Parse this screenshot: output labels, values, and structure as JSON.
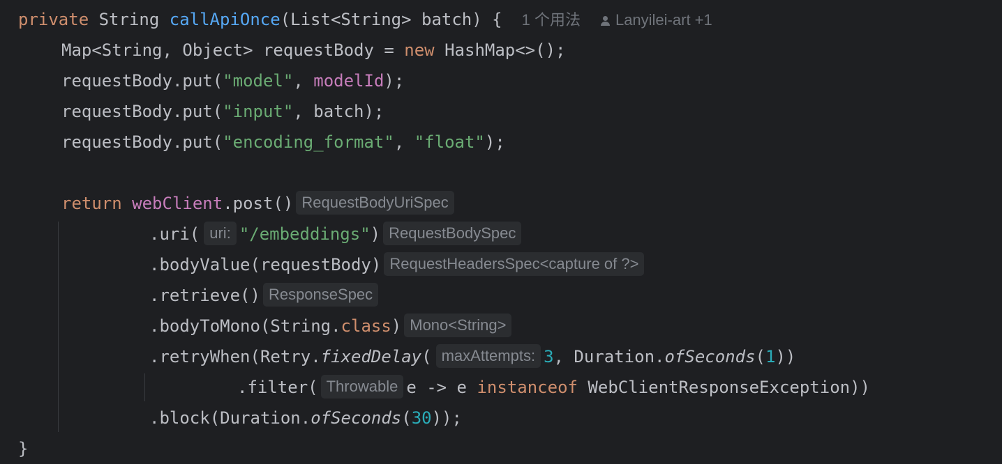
{
  "lines": {
    "l1": {
      "kw1": "private",
      "t1": " String ",
      "fn": "callApiOnce",
      "t2": "(List<String> batch) {"
    },
    "meta": {
      "usage": "1 个用法",
      "author": "Lanyilei-art +1"
    },
    "l2": {
      "t1": "Map<String, Object> requestBody = ",
      "kw": "new",
      "t2": " HashMap<>();"
    },
    "l3": {
      "t1": "requestBody.put(",
      "s1": "\"model\"",
      "t2": ", ",
      "fld": "modelId",
      "t3": ");"
    },
    "l4": {
      "t1": "requestBody.put(",
      "s1": "\"input\"",
      "t2": ", batch);"
    },
    "l5": {
      "t1": "requestBody.put(",
      "s1": "\"encoding_format\"",
      "t2": ", ",
      "s2": "\"float\"",
      "t3": ");"
    },
    "l7": {
      "kw": "return",
      "sp": " ",
      "fld": "webClient",
      "t1": ".post()",
      "hint": "RequestBodyUriSpec"
    },
    "l8": {
      "t1": ".uri(",
      "param": "uri:",
      "s1": "\"/embeddings\"",
      "t2": ")",
      "hint": "RequestBodySpec"
    },
    "l9": {
      "t1": ".bodyValue(requestBody)",
      "hint": "RequestHeadersSpec<capture of ?>"
    },
    "l10": {
      "t1": ".retrieve()",
      "hint": "ResponseSpec"
    },
    "l11": {
      "t1": ".bodyToMono(String.",
      "kw": "class",
      "t2": ")",
      "hint": "Mono<String>"
    },
    "l12": {
      "t1": ".retryWhen(Retry.",
      "it1": "fixedDelay",
      "t2": "(",
      "param": "maxAttempts:",
      "n1": "3",
      "t3": ", Duration.",
      "it2": "ofSeconds",
      "t4": "(",
      "n2": "1",
      "t5": "))"
    },
    "l13": {
      "t1": ".filter(",
      "hint": "Throwable",
      "t2": "e -> e ",
      "kw": "instanceof",
      "t3": " WebClientResponseException))"
    },
    "l14": {
      "t1": ".block(Duration.",
      "it": "ofSeconds",
      "t2": "(",
      "n": "30",
      "t3": "));"
    },
    "l15": {
      "t1": "}"
    }
  },
  "colors": {
    "background": "#1e1f22",
    "keyword": "#cf8e6d",
    "function": "#56a8f5",
    "string": "#6aab73",
    "field": "#c77dbb",
    "number": "#2aacb8",
    "hint_bg": "#2b2d30"
  }
}
